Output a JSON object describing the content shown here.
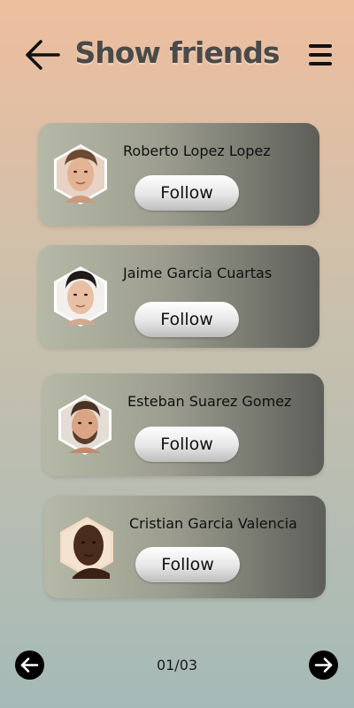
{
  "header": {
    "title": "Show friends",
    "back_icon": "arrow-left-icon",
    "menu_icon": "hamburger-menu-icon"
  },
  "friends": [
    {
      "name": "Roberto Lopez Lopez",
      "button_label": "Follow",
      "avatar_icon": "avatar-photo-icon"
    },
    {
      "name": "Jaime Garcia Cuartas",
      "button_label": "Follow",
      "avatar_icon": "avatar-photo-icon"
    },
    {
      "name": "Esteban Suarez Gomez",
      "button_label": "Follow",
      "avatar_icon": "avatar-photo-icon"
    },
    {
      "name": "Cristian Garcia Valencia",
      "button_label": "Follow",
      "avatar_icon": "avatar-photo-icon"
    }
  ],
  "pagination": {
    "current_page": "01",
    "total_pages": "03",
    "indicator": "01/03",
    "prev_icon": "arrow-left-circle-icon",
    "next_icon": "arrow-right-circle-icon"
  },
  "colors": {
    "background_top": "#efbe9e",
    "background_bottom": "#a5bab7",
    "card_light": "#b6b9a7",
    "card_dark": "#5d5e58",
    "title": "#4a4a48"
  }
}
